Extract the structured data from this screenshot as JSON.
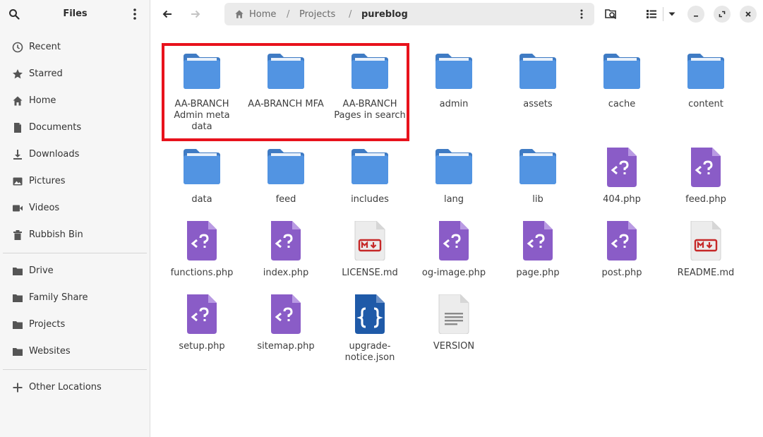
{
  "sidebar": {
    "title": "Files",
    "items": [
      {
        "label": "Recent",
        "icon": "clock-icon"
      },
      {
        "label": "Starred",
        "icon": "star-icon"
      },
      {
        "label": "Home",
        "icon": "home-icon"
      },
      {
        "label": "Documents",
        "icon": "document-icon"
      },
      {
        "label": "Downloads",
        "icon": "download-icon"
      },
      {
        "label": "Pictures",
        "icon": "picture-icon"
      },
      {
        "label": "Videos",
        "icon": "video-icon"
      },
      {
        "label": "Rubbish Bin",
        "icon": "trash-icon"
      },
      {
        "label": "Drive",
        "icon": "folder-icon"
      },
      {
        "label": "Family Share",
        "icon": "folder-icon"
      },
      {
        "label": "Projects",
        "icon": "folder-icon"
      },
      {
        "label": "Websites",
        "icon": "folder-icon"
      },
      {
        "label": "Other Locations",
        "icon": "plus-icon"
      }
    ]
  },
  "pathbar": {
    "crumbs": [
      "Home",
      "Projects",
      "pureblog"
    ],
    "separator": "/"
  },
  "files": [
    {
      "name": "AA-BRANCH Admin meta data",
      "type": "folder"
    },
    {
      "name": "AA-BRANCH MFA",
      "type": "folder"
    },
    {
      "name": "AA-BRANCH Pages in search",
      "type": "folder"
    },
    {
      "name": "admin",
      "type": "folder"
    },
    {
      "name": "assets",
      "type": "folder"
    },
    {
      "name": "cache",
      "type": "folder"
    },
    {
      "name": "content",
      "type": "folder"
    },
    {
      "name": "data",
      "type": "folder"
    },
    {
      "name": "feed",
      "type": "folder"
    },
    {
      "name": "includes",
      "type": "folder"
    },
    {
      "name": "lang",
      "type": "folder"
    },
    {
      "name": "lib",
      "type": "folder"
    },
    {
      "name": "404.php",
      "type": "php"
    },
    {
      "name": "feed.php",
      "type": "php"
    },
    {
      "name": "functions.php",
      "type": "php"
    },
    {
      "name": "index.php",
      "type": "php"
    },
    {
      "name": "LICENSE.md",
      "type": "markdown"
    },
    {
      "name": "og-image.php",
      "type": "php"
    },
    {
      "name": "page.php",
      "type": "php"
    },
    {
      "name": "post.php",
      "type": "php"
    },
    {
      "name": "README.md",
      "type": "markdown"
    },
    {
      "name": "setup.php",
      "type": "php"
    },
    {
      "name": "sitemap.php",
      "type": "php"
    },
    {
      "name": "upgrade-notice.json",
      "type": "json"
    },
    {
      "name": "VERSION",
      "type": "text"
    }
  ],
  "colors": {
    "folder": "#5294e2",
    "folder_dark": "#3f7bc4",
    "php": "#8a5cc7",
    "php_fold": "#b99ae3",
    "json": "#1f5aa8",
    "highlight": "#e8121c"
  }
}
